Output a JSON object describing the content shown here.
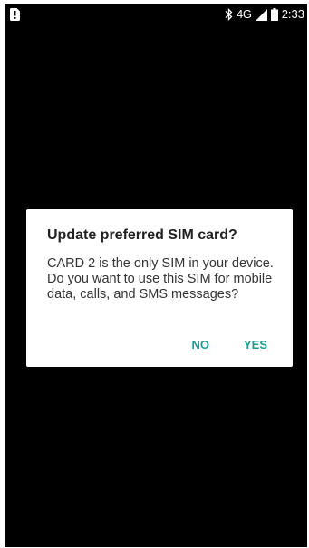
{
  "status_bar": {
    "left_icon": "sim-alert-icon",
    "bluetooth_icon": "bluetooth-icon",
    "network_type": "4G",
    "signal_icon": "signal-icon",
    "battery_icon": "battery-icon",
    "time": "2:33"
  },
  "dialog": {
    "title": "Update preferred SIM card?",
    "message": "CARD 2 is the only SIM in your device. Do you want to use this SIM for mobile data, calls, and SMS messages?",
    "buttons": {
      "no_label": "NO",
      "yes_label": "YES"
    }
  },
  "colors": {
    "screen_background": "#000000",
    "dialog_background": "#ffffff",
    "accent": "#1a9c8f",
    "title_text": "#212121"
  }
}
